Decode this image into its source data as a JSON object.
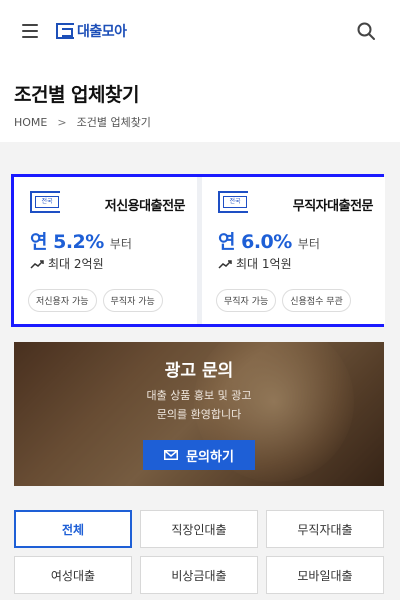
{
  "header": {
    "logo_text": "대출모아"
  },
  "page": {
    "title": "조건별 업체찾기",
    "breadcrumb": [
      "HOME",
      ">",
      "조건별 업체찾기"
    ]
  },
  "cards": [
    {
      "badge": "전국",
      "name": "저신용대출전문",
      "rate": "연 5.2%",
      "rate_suffix": "부터",
      "limit": "최대 2억원",
      "tags": [
        "저신용자 가능",
        "무직자 가능"
      ]
    },
    {
      "badge": "전국",
      "name": "무직자대출전문",
      "rate": "연 6.0%",
      "rate_suffix": "부터",
      "limit": "최대 1억원",
      "tags": [
        "무직자 가능",
        "신용점수 무관"
      ]
    }
  ],
  "banner": {
    "title": "광고 문의",
    "line1": "대출 상품 홍보 및 광고",
    "line2": "문의를 환영합니다",
    "button": "문의하기"
  },
  "filters": [
    "전체",
    "직장인대출",
    "무직자대출",
    "여성대출",
    "비상금대출",
    "모바일대출"
  ],
  "colors": {
    "accent": "#1e5fd6",
    "highlight_border": "#1a1aff"
  }
}
